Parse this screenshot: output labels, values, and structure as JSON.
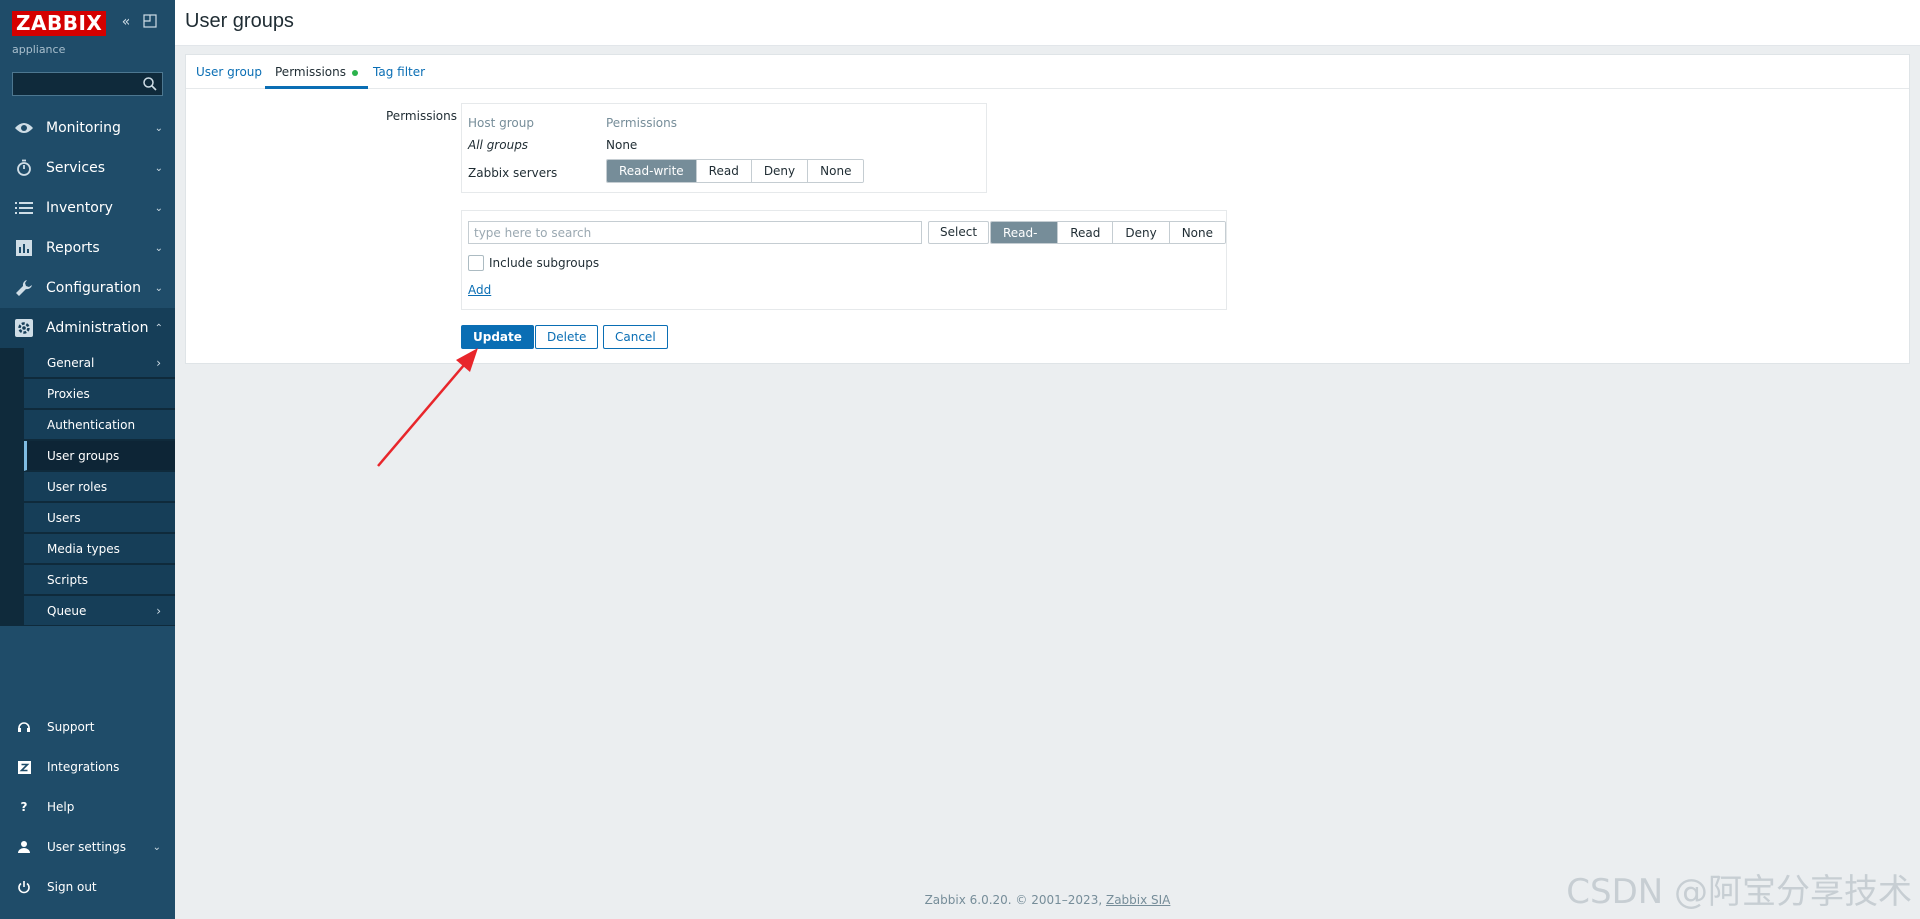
{
  "sidebar": {
    "brand": "ZABBIX",
    "brand_sub": "appliance",
    "nav": [
      {
        "label": "Monitoring",
        "icon": "eye-icon"
      },
      {
        "label": "Services",
        "icon": "stopwatch-icon"
      },
      {
        "label": "Inventory",
        "icon": "list-icon"
      },
      {
        "label": "Reports",
        "icon": "bar-chart-icon"
      },
      {
        "label": "Configuration",
        "icon": "wrench-icon"
      },
      {
        "label": "Administration",
        "icon": "gear-icon"
      }
    ],
    "submenu": [
      {
        "label": "General"
      },
      {
        "label": "Proxies"
      },
      {
        "label": "Authentication"
      },
      {
        "label": "User groups"
      },
      {
        "label": "User roles"
      },
      {
        "label": "Users"
      },
      {
        "label": "Media types"
      },
      {
        "label": "Scripts"
      },
      {
        "label": "Queue"
      }
    ],
    "bottom": [
      {
        "label": "Support",
        "icon": "headset-icon"
      },
      {
        "label": "Integrations",
        "icon": "z-icon"
      },
      {
        "label": "Help",
        "icon": "question-icon"
      },
      {
        "label": "User settings",
        "icon": "user-icon"
      },
      {
        "label": "Sign out",
        "icon": "power-icon"
      }
    ]
  },
  "header": {
    "title": "User groups"
  },
  "tabs": [
    {
      "label": "User group"
    },
    {
      "label": "Permissions"
    },
    {
      "label": "Tag filter"
    }
  ],
  "permissions": {
    "label": "Permissions",
    "col_host_group": "Host group",
    "col_permissions": "Permissions",
    "row_all_groups": "All groups",
    "row_all_value": "None",
    "row_zabbix": "Zabbix servers",
    "options": [
      "Read-write",
      "Read",
      "Deny",
      "None"
    ],
    "selected": "Read-write"
  },
  "add": {
    "search_placeholder": "type here to search",
    "select_label": "Select",
    "options": [
      "Read-write",
      "Read",
      "Deny",
      "None"
    ],
    "selected": "Read-write",
    "include_subgroups": "Include subgroups",
    "add_link": "Add"
  },
  "actions": {
    "update": "Update",
    "delete": "Delete",
    "cancel": "Cancel"
  },
  "footer": {
    "text": "Zabbix 6.0.20. © 2001–2023, ",
    "link": "Zabbix SIA"
  },
  "watermark": "CSDN @阿宝分享技术",
  "colors": {
    "brand": "#d40000",
    "sidebar": "#1f4c69",
    "primary": "#0a6eb4",
    "arrow": "#e8262b"
  }
}
